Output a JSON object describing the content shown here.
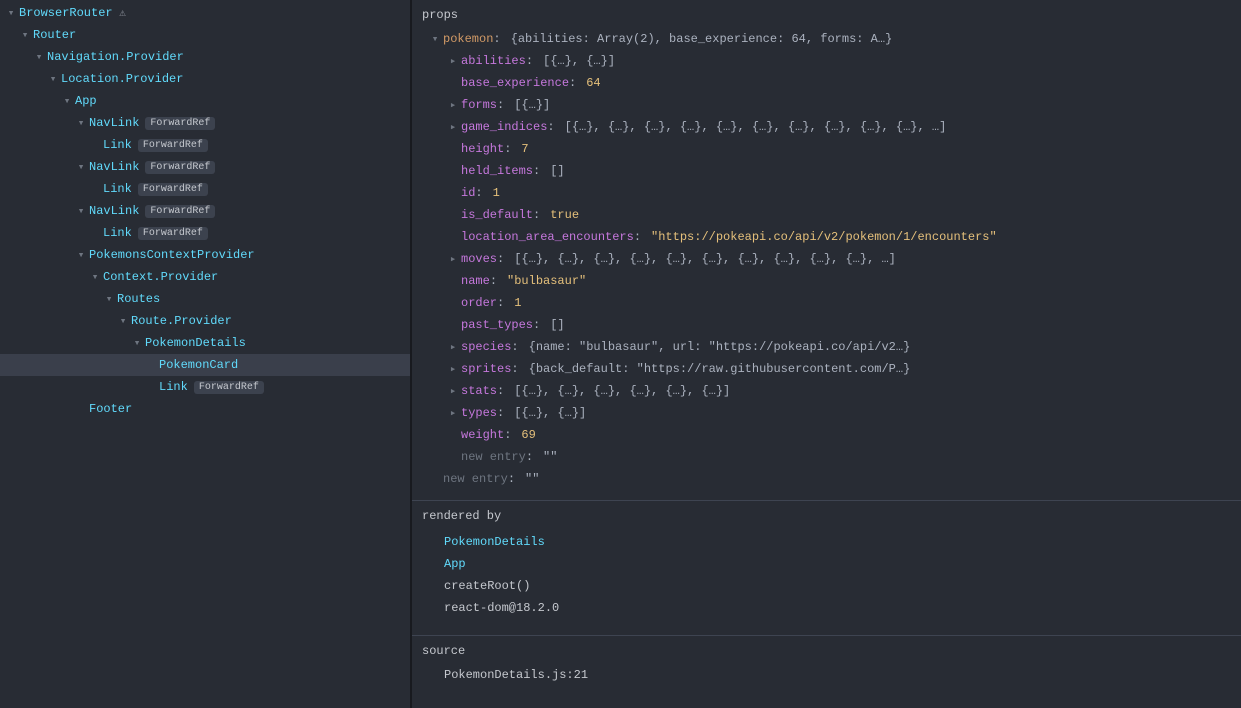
{
  "tree": [
    {
      "indent": 0,
      "arrow": "down",
      "name": "BrowserRouter",
      "warn": true
    },
    {
      "indent": 1,
      "arrow": "down",
      "name": "Router"
    },
    {
      "indent": 2,
      "arrow": "down",
      "name": "Navigation.Provider"
    },
    {
      "indent": 3,
      "arrow": "down",
      "name": "Location.Provider"
    },
    {
      "indent": 4,
      "arrow": "down",
      "name": "App"
    },
    {
      "indent": 5,
      "arrow": "down",
      "name": "NavLink",
      "badge": "ForwardRef"
    },
    {
      "indent": 6,
      "arrow": "leaf",
      "name": "Link",
      "badge": "ForwardRef"
    },
    {
      "indent": 5,
      "arrow": "down",
      "name": "NavLink",
      "badge": "ForwardRef"
    },
    {
      "indent": 6,
      "arrow": "leaf",
      "name": "Link",
      "badge": "ForwardRef"
    },
    {
      "indent": 5,
      "arrow": "down",
      "name": "NavLink",
      "badge": "ForwardRef"
    },
    {
      "indent": 6,
      "arrow": "leaf",
      "name": "Link",
      "badge": "ForwardRef"
    },
    {
      "indent": 5,
      "arrow": "down",
      "name": "PokemonsContextProvider"
    },
    {
      "indent": 6,
      "arrow": "down",
      "name": "Context.Provider"
    },
    {
      "indent": 7,
      "arrow": "down",
      "name": "Routes"
    },
    {
      "indent": 8,
      "arrow": "down",
      "name": "Route.Provider"
    },
    {
      "indent": 9,
      "arrow": "down",
      "name": "PokemonDetails"
    },
    {
      "indent": 10,
      "arrow": "leaf",
      "name": "PokemonCard",
      "selected": true
    },
    {
      "indent": 10,
      "arrow": "leaf",
      "name": "Link",
      "badge": "ForwardRef"
    },
    {
      "indent": 5,
      "arrow": "leaf",
      "name": "Footer"
    }
  ],
  "props": {
    "header": "props",
    "root": {
      "key": "pokemon",
      "preview": "{abilities: Array(2), base_experience: 64, forms: A…}"
    },
    "items": [
      {
        "arrow": "right",
        "key": "abilities",
        "type": "preview",
        "value": "[{…}, {…}]"
      },
      {
        "arrow": "none",
        "key": "base_experience",
        "type": "num",
        "value": "64"
      },
      {
        "arrow": "right",
        "key": "forms",
        "type": "preview",
        "value": "[{…}]"
      },
      {
        "arrow": "right",
        "key": "game_indices",
        "type": "preview",
        "value": "[{…}, {…}, {…}, {…}, {…}, {…}, {…}, {…}, {…}, {…}, …]"
      },
      {
        "arrow": "none",
        "key": "height",
        "type": "num",
        "value": "7"
      },
      {
        "arrow": "none",
        "key": "held_items",
        "type": "preview",
        "value": "[]"
      },
      {
        "arrow": "none",
        "key": "id",
        "type": "num",
        "value": "1"
      },
      {
        "arrow": "none",
        "key": "is_default",
        "type": "bool",
        "value": "true"
      },
      {
        "arrow": "none",
        "key": "location_area_encounters",
        "type": "str",
        "value": "\"https://pokeapi.co/api/v2/pokemon/1/encounters\""
      },
      {
        "arrow": "right",
        "key": "moves",
        "type": "preview",
        "value": "[{…}, {…}, {…}, {…}, {…}, {…}, {…}, {…}, {…}, {…}, …]"
      },
      {
        "arrow": "none",
        "key": "name",
        "type": "str",
        "value": "\"bulbasaur\""
      },
      {
        "arrow": "none",
        "key": "order",
        "type": "num",
        "value": "1"
      },
      {
        "arrow": "none",
        "key": "past_types",
        "type": "preview",
        "value": "[]"
      },
      {
        "arrow": "right",
        "key": "species",
        "type": "preview",
        "value": "{name: \"bulbasaur\", url: \"https://pokeapi.co/api/v2…}"
      },
      {
        "arrow": "right",
        "key": "sprites",
        "type": "preview",
        "value": "{back_default: \"https://raw.githubusercontent.com/P…}"
      },
      {
        "arrow": "right",
        "key": "stats",
        "type": "preview",
        "value": "[{…}, {…}, {…}, {…}, {…}, {…}]"
      },
      {
        "arrow": "right",
        "key": "types",
        "type": "preview",
        "value": "[{…}, {…}]"
      },
      {
        "arrow": "none",
        "key": "weight",
        "type": "num",
        "value": "69"
      },
      {
        "arrow": "none",
        "key": "new entry",
        "type": "empty",
        "value": "\"\"",
        "dim": true
      }
    ],
    "new_entry_outer": {
      "key": "new entry",
      "value": "\"\""
    }
  },
  "rendered_by": {
    "header": "rendered by",
    "items": [
      {
        "text": "PokemonDetails",
        "link": true
      },
      {
        "text": "App",
        "link": true
      },
      {
        "text": "createRoot()",
        "link": false
      },
      {
        "text": "react-dom@18.2.0",
        "link": false
      }
    ]
  },
  "source": {
    "header": "source",
    "text": "PokemonDetails.js:21"
  }
}
